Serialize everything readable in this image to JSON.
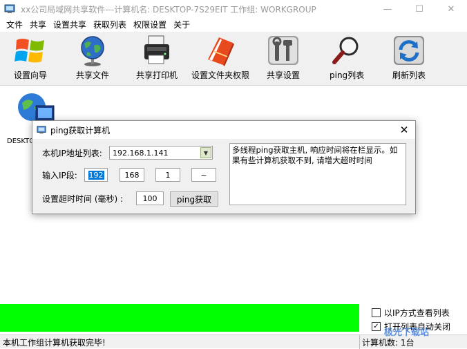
{
  "window": {
    "title": "xx公司局域网共享软件---计算机名: DESKTOP-7S29EIT    工作组: WORKGROUP",
    "minimize": "—",
    "maximize": "☐",
    "close": "✕"
  },
  "menu": [
    "文件",
    "共享",
    "设置共享",
    "获取列表",
    "权限设置",
    "关于"
  ],
  "toolbar": [
    {
      "label": "设置向导",
      "icon": "windows-logo-icon"
    },
    {
      "label": "共享文件",
      "icon": "globe-icon"
    },
    {
      "label": "共享打印机",
      "icon": "printer-icon"
    },
    {
      "label": "设置文件夹权限",
      "icon": "folder-book-icon"
    },
    {
      "label": "共享设置",
      "icon": "tools-icon"
    },
    {
      "label": "ping列表",
      "icon": "magnifier-icon"
    },
    {
      "label": "刷新列表",
      "icon": "refresh-icon"
    }
  ],
  "computer_list": [
    {
      "name": "DESKTO"
    }
  ],
  "dialog": {
    "title": "ping获取计算机",
    "close": "✕",
    "ip_list_label": "本机IP地址列表:",
    "ip_list_value": "192.168.1.141",
    "ip_segment_label": "输入IP段:",
    "ip1": "192",
    "ip2": "168",
    "ip3": "1",
    "ip4": "~",
    "timeout_label": "设置超时时间 (毫秒) :",
    "timeout_value": "100",
    "ping_button": "ping获取",
    "message": "多线程ping获取主机, 响应时间将在栏显示。如果有些计算机获取不到, 请增大超时时间"
  },
  "progress": {
    "value": 1.0,
    "color": "#00ff00"
  },
  "options": [
    {
      "label": "以IP方式查看列表",
      "checked": false
    },
    {
      "label": "打开列表自动关闭",
      "checked": true
    }
  ],
  "status": {
    "left": "本机工作组计算机获取完毕!",
    "right": "计算机数: 1台"
  },
  "watermark": "极光下载站"
}
